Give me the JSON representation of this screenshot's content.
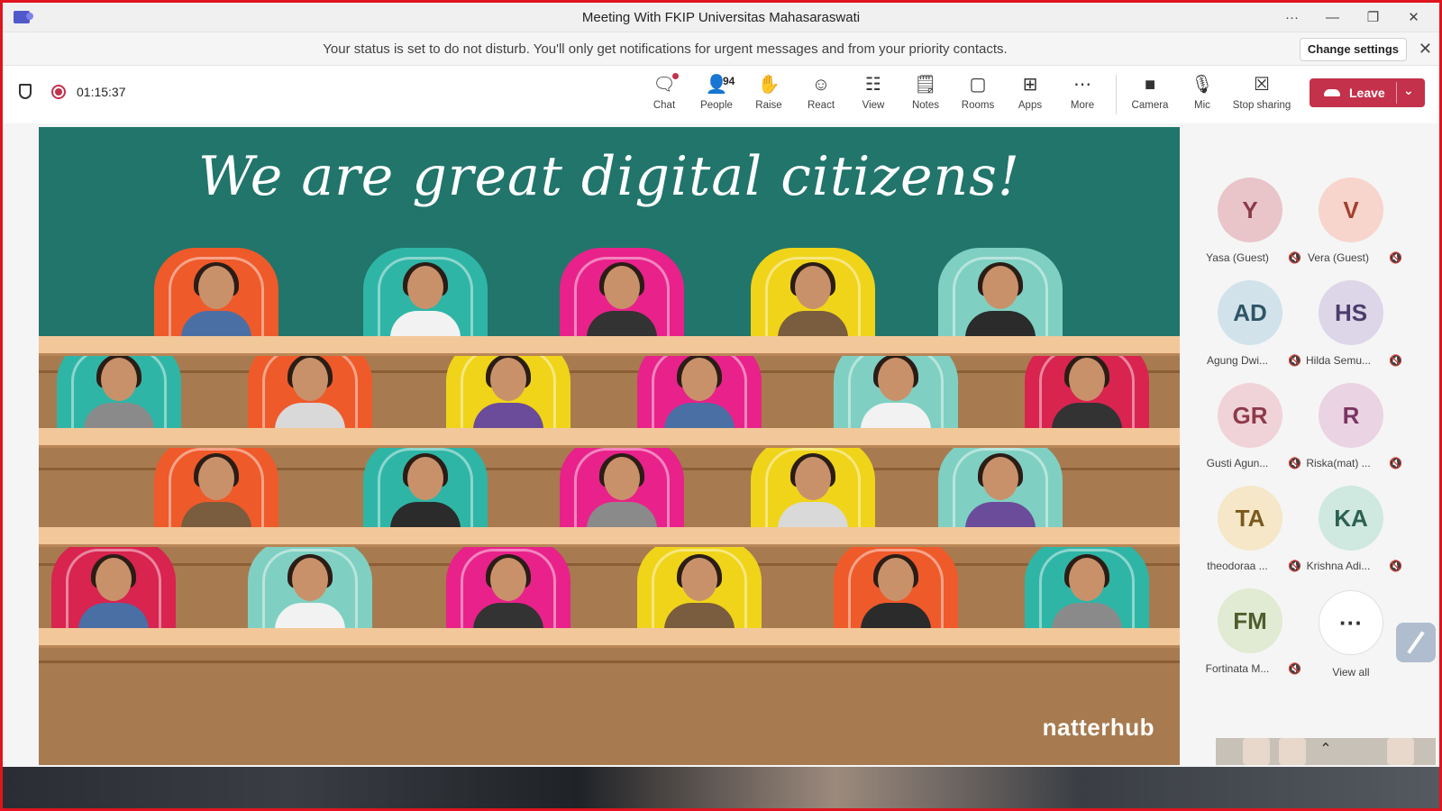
{
  "window": {
    "title": "Meeting With FKIP Universitas Mahasaraswati",
    "more_label": "···",
    "minimize": "—",
    "restore": "❐",
    "close": "✕"
  },
  "notification": {
    "message": "Your status is set to do not disturb. You'll only get notifications for urgent messages and from your priority contacts.",
    "button": "Change settings",
    "close": "✕"
  },
  "toolbar": {
    "timer": "01:15:37",
    "tools": {
      "chat": "Chat",
      "people": "People",
      "people_count": "94",
      "raise": "Raise",
      "react": "React",
      "view": "View",
      "notes": "Notes",
      "rooms": "Rooms",
      "apps": "Apps",
      "more": "More",
      "camera": "Camera",
      "mic": "Mic",
      "stop_sharing": "Stop sharing"
    },
    "leave": "Leave",
    "chevron": "⌄"
  },
  "stage": {
    "headline": "We are great digital citizens!",
    "brand": "natterhub"
  },
  "participants": [
    {
      "initials": "Y",
      "name": "Yasa (Guest)",
      "color": "#e9c4c9",
      "text_color": "#8a3b48"
    },
    {
      "initials": "V",
      "name": "Vera (Guest)",
      "color": "#f7d4cc",
      "text_color": "#a1412e"
    },
    {
      "initials": "AD",
      "name": "Agung Dwi...",
      "color": "#d1e2ea",
      "text_color": "#2f5567"
    },
    {
      "initials": "HS",
      "name": "Hilda Semu...",
      "color": "#dcd6e8",
      "text_color": "#4b3d6b"
    },
    {
      "initials": "GR",
      "name": "Gusti Agun...",
      "color": "#f0d3d8",
      "text_color": "#8e3a4a"
    },
    {
      "initials": "R",
      "name": "Riska(mat) ...",
      "color": "#ead3e2",
      "text_color": "#7b3561"
    },
    {
      "initials": "TA",
      "name": "theodoraa ...",
      "color": "#f5e7c7",
      "text_color": "#7a5a1c"
    },
    {
      "initials": "KA",
      "name": "Krishna Adi...",
      "color": "#cfe8e0",
      "text_color": "#2c6152"
    },
    {
      "initials": "FM",
      "name": "Fortinata M...",
      "color": "#e1ead2",
      "text_color": "#4d5e2e"
    }
  ],
  "view_all": {
    "label": "View all",
    "dots": "···"
  }
}
